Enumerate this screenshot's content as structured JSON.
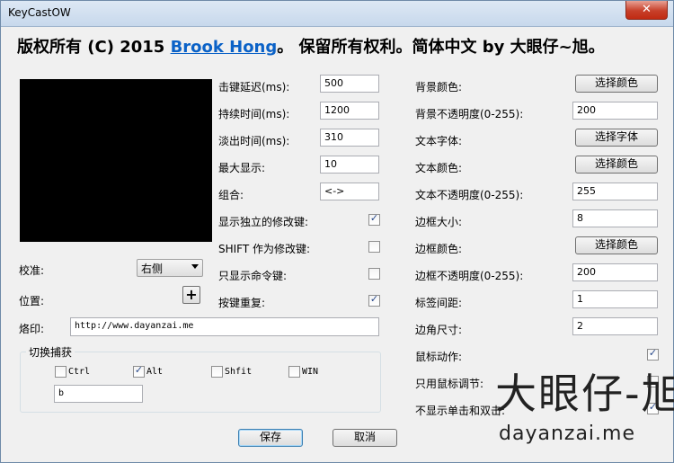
{
  "window": {
    "title": "KeyCastOW",
    "close_glyph": "✕"
  },
  "copyright": {
    "prefix": "版权所有 (C) 2015 ",
    "link": "Brook Hong",
    "suffix": "。 保留所有权利。简体中文 by 大眼仔~旭。"
  },
  "left": {
    "calibrate_label": "校准:",
    "calibrate_value": "右侧",
    "position_label": "位置:",
    "position_button": "+",
    "stamp_label": "烙印:",
    "stamp_value": "http://www.dayanzai.me"
  },
  "capture": {
    "title": "切换捕获",
    "ctrl": {
      "label": "Ctrl",
      "checked": false
    },
    "alt": {
      "label": "Alt",
      "checked": true
    },
    "shift": {
      "label": "Shfit",
      "checked": false
    },
    "win": {
      "label": "WIN",
      "checked": false
    },
    "key_value": "b"
  },
  "middle": {
    "keystroke_delay": {
      "label": "击键延迟(ms):",
      "value": "500"
    },
    "duration": {
      "label": "持续时间(ms):",
      "value": "1200"
    },
    "fade_time": {
      "label": "淡出时间(ms):",
      "value": "310"
    },
    "max_display": {
      "label": "最大显示:",
      "value": "10"
    },
    "combo": {
      "label": "组合:",
      "value": "<->"
    },
    "show_modifiers": {
      "label": "显示独立的修改键:",
      "checked": true
    },
    "shift_modifier": {
      "label": "SHIFT 作为修改键:",
      "checked": false
    },
    "commands_only": {
      "label": "只显示命令键:",
      "checked": false
    },
    "key_repeat": {
      "label": "按键重复:",
      "checked": true
    }
  },
  "right": {
    "bg_color": {
      "label": "背景颜色:",
      "button": "选择颜色"
    },
    "bg_opacity": {
      "label": "背景不透明度(0-255):",
      "value": "200"
    },
    "text_font": {
      "label": "文本字体:",
      "button": "选择字体"
    },
    "text_color": {
      "label": "文本颜色:",
      "button": "选择颜色"
    },
    "text_opacity": {
      "label": "文本不透明度(0-255):",
      "value": "255"
    },
    "border_size": {
      "label": "边框大小:",
      "value": "8"
    },
    "border_color": {
      "label": "边框颜色:",
      "button": "选择颜色"
    },
    "border_opacity": {
      "label": "边框不透明度(0-255):",
      "value": "200"
    },
    "label_spacing": {
      "label": "标签间距:",
      "value": "1"
    },
    "corner_size": {
      "label": "边角尺寸:",
      "value": "2"
    },
    "mouse_action": {
      "label": "鼠标动作:",
      "checked": true
    },
    "mouse_adjust_only": {
      "label": "只用鼠标调节:",
      "checked": false
    },
    "hide_clicks": {
      "label": "不显示单击和双击:",
      "checked": true
    }
  },
  "footer": {
    "save": "保存",
    "cancel": "取消"
  },
  "watermark": {
    "top": "大眼仔-旭",
    "bottom": "dayanzai.me"
  },
  "colors": {
    "accent": "#0b62c7",
    "preview_bg": "#000000",
    "close": "#c7402a"
  }
}
